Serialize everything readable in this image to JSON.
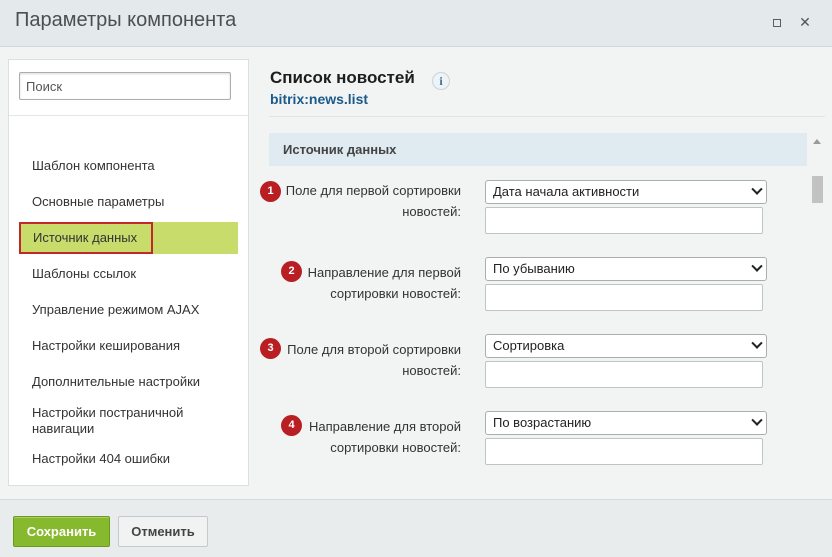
{
  "window": {
    "title": "Параметры компонента",
    "maximize_icon": "maximize-icon",
    "close_icon": "close-icon",
    "close_glyph": "✕"
  },
  "sidebar": {
    "search_placeholder": "Поиск",
    "items": [
      {
        "label": "Шаблон компонента"
      },
      {
        "label": "Основные параметры"
      },
      {
        "label": "Источник данных",
        "active": true
      },
      {
        "label": "Шаблоны ссылок"
      },
      {
        "label": "Управление режимом AJAX"
      },
      {
        "label": "Настройки кеширования"
      },
      {
        "label": "Дополнительные настройки"
      },
      {
        "label": "Настройки постраничной навигации"
      },
      {
        "label": "Настройки 404 ошибки"
      }
    ]
  },
  "main": {
    "component_title": "Список новостей",
    "info_glyph": "i",
    "component_code": "bitrix:news.list",
    "section_title": "Источник данных",
    "fields": [
      {
        "badge": "1",
        "label_line1": "Поле для первой сортировки",
        "label_line2": "новостей:",
        "value": "Дата начала активности"
      },
      {
        "badge": "2",
        "label_line1": "Направление для первой",
        "label_line2": "сортировки новостей:",
        "value": "По убыванию"
      },
      {
        "badge": "3",
        "label_line1": "Поле для второй сортировки",
        "label_line2": "новостей:",
        "value": "Сортировка"
      },
      {
        "badge": "4",
        "label_line1": "Направление для второй",
        "label_line2": "сортировки новостей:",
        "value": "По возрастанию"
      }
    ]
  },
  "footer": {
    "save_label": "Сохранить",
    "cancel_label": "Отменить"
  },
  "colors": {
    "active_nav_bg": "#c7dc6b",
    "highlight_border": "#c0282c",
    "badge_bg": "#b81e22",
    "save_button_bg": "#87b92e",
    "section_header_bg": "#dfeaf1",
    "link_code": "#1b5a8a"
  }
}
